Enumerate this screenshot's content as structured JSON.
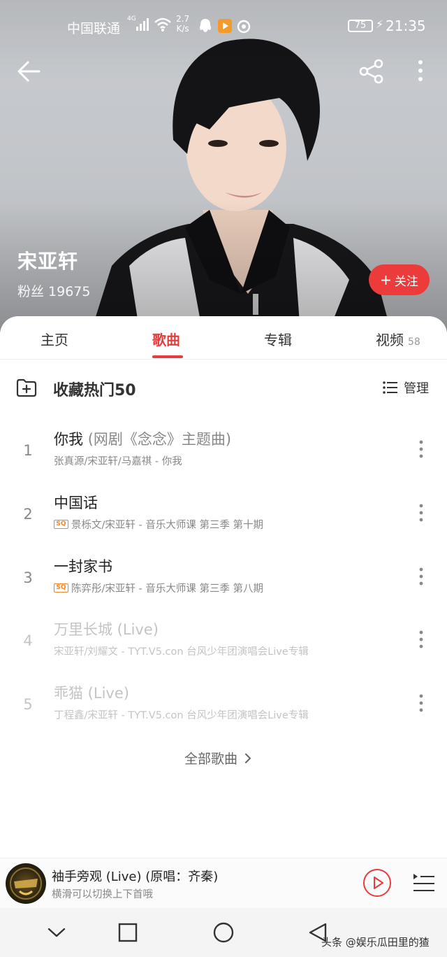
{
  "status_bar": {
    "carrier": "中国联通",
    "network": "4G",
    "net_speed_value": "2.7",
    "net_speed_unit": "K/s",
    "battery": "75",
    "time": "21:35"
  },
  "artist": {
    "name": "宋亚轩",
    "fans_label": "粉丝 19675",
    "follow_label": "关注"
  },
  "tabs": [
    {
      "label": "主页"
    },
    {
      "label": "歌曲"
    },
    {
      "label": "专辑"
    },
    {
      "label": "视频",
      "count": "58"
    }
  ],
  "active_tab": "歌曲",
  "list_header": {
    "collect_label": "收藏热门50",
    "manage_label": "管理"
  },
  "songs": [
    {
      "index": "1",
      "title": "你我",
      "title_extra": "(网剧《念念》主题曲)",
      "sq": false,
      "subtitle": "张真源/宋亚轩/马嘉祺 - 你我",
      "available": true
    },
    {
      "index": "2",
      "title": "中国话",
      "title_extra": "",
      "sq": true,
      "sq_label": "SQ",
      "subtitle": "景栎文/宋亚轩 - 音乐大师课 第三季 第十期",
      "available": true
    },
    {
      "index": "3",
      "title": "一封家书",
      "title_extra": "",
      "sq": true,
      "sq_label": "SQ",
      "subtitle": "陈弈彤/宋亚轩 - 音乐大师课 第三季 第八期",
      "available": true
    },
    {
      "index": "4",
      "title": "万里长城 (Live)",
      "title_extra": "",
      "sq": false,
      "subtitle": "宋亚轩/刘耀文 - TYT.V5.con 台风少年团演唱会Live专辑",
      "available": false
    },
    {
      "index": "5",
      "title": "乖猫 (Live)",
      "title_extra": "",
      "sq": false,
      "subtitle": "丁程鑫/宋亚轩 - TYT.V5.con 台风少年团演唱会Live专辑",
      "available": false
    }
  ],
  "all_songs_label": "全部歌曲",
  "player": {
    "title": "袖手旁观 (Live) (原唱：齐秦)",
    "hint": "横滑可以切换上下首哦"
  },
  "watermark": "头条 @娱乐瓜田里的猹",
  "colors": {
    "accent": "#e53d3d",
    "follow_button": "#ec3b3b",
    "sq_badge": "#f0852c"
  }
}
